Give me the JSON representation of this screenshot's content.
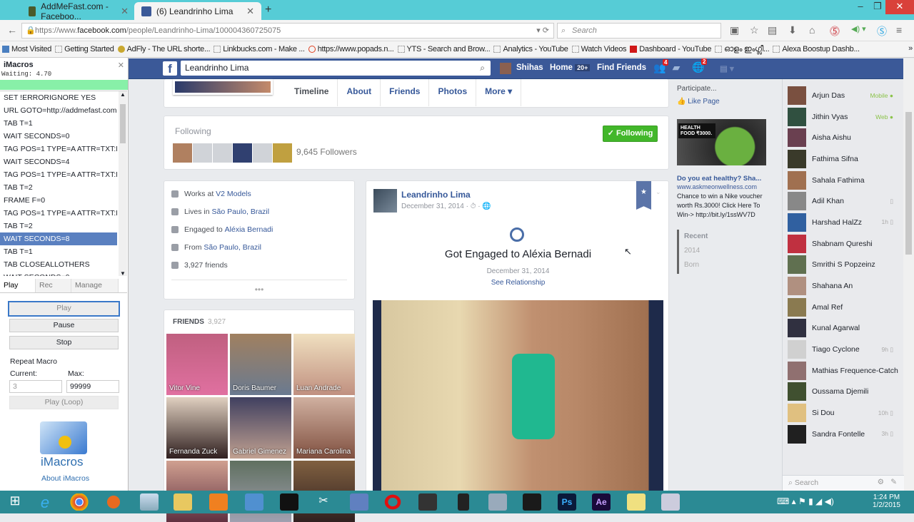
{
  "browser": {
    "tabs": [
      {
        "label": "AddMeFast.com - Faceboo...",
        "active": false
      },
      {
        "label": "(6) Leandrinho Lima",
        "active": true
      }
    ],
    "url_prefix": "https://www.",
    "url_domain": "facebook.com",
    "url_path": "/people/Leandrinho-Lima/100004360725075",
    "search_placeholder": "Search",
    "bookmarks": [
      "Most Visited",
      "Getting Started",
      "AdFly - The URL shorte...",
      "Linkbucks.com - Make ...",
      "https://www.popads.n...",
      "YTS - Search and Brow...",
      "Analytics - YouTube",
      "Watch Videos",
      "Dashboard - YouTube",
      "ഓളം ഇംഗ്ലീ...",
      "Alexa Boostup Dashb..."
    ]
  },
  "imacros": {
    "title": "iMacros",
    "status": "Waiting: 4.70",
    "lines": [
      "SET !ERRORIGNORE YES",
      "URL GOTO=http://addmefast.com...",
      "TAB T=1",
      "WAIT SECONDS=0",
      "TAG POS=1 TYPE=A ATTR=TXT:Fa...",
      "WAIT SECONDS=4",
      "TAG POS=1 TYPE=A ATTR=TXT:Fo...",
      "TAB T=2",
      "FRAME F=0",
      "TAG POS=1 TYPE=A ATTR=TXT:Fo...",
      "TAB T=2",
      "WAIT SECONDS=8",
      "TAB T=1",
      "TAB CLOSEALLOTHERS",
      "WAIT SECONDS=0"
    ],
    "selected_index": 11,
    "tabs": [
      "Play",
      "Rec",
      "Manage"
    ],
    "play": "Play",
    "pause": "Pause",
    "stop": "Stop",
    "repeat_label": "Repeat Macro",
    "current_label": "Current:",
    "max_label": "Max:",
    "current_value": "3",
    "max_value": "99999",
    "play_loop": "Play (Loop)",
    "logo_text": "iMacros",
    "about": "About iMacros"
  },
  "fb": {
    "search_value": "Leandrinho Lima",
    "user": "Shihas",
    "home": "Home",
    "home_badge": "20+",
    "find_friends": "Find Friends",
    "friend_requests_badge": "4",
    "notifications_badge": "2",
    "profile_tabs": [
      "Timeline",
      "About",
      "Friends",
      "Photos",
      "More ▾"
    ],
    "following_label": "Following",
    "followers": "9,645 Followers",
    "following_button": "✓ Following",
    "intro": [
      {
        "icon": "briefcase-icon",
        "text": "Works at ",
        "link": "V2 Models"
      },
      {
        "icon": "home-icon",
        "text": "Lives in ",
        "link": "São Paulo, Brazil"
      },
      {
        "icon": "heart-icon",
        "text": "Engaged to ",
        "link": "Aléxia Bernadi"
      },
      {
        "icon": "pin-icon",
        "text": "From ",
        "link": "São Paulo, Brazil"
      },
      {
        "icon": "friends-icon",
        "text": "3,927 friends",
        "link": ""
      }
    ],
    "friends_title": "FRIENDS",
    "friends_count": "3,927",
    "friends": [
      "Vitor Vine",
      "Doris Baumer",
      "Luan Andrade",
      "Fernanda Zuck",
      "Gabriel Gimenez",
      "Mariana Carolina",
      "",
      "",
      ""
    ],
    "post": {
      "author": "Leandrinho Lima",
      "date": "December 31, 2014 · ⏱ · 🌐",
      "headline": "Got Engaged to Aléxia Bernadi",
      "event_date": "December 31, 2014",
      "see_relationship": "See Relationship"
    },
    "ad": {
      "participate": "Participate...",
      "like_page": "Like Page",
      "image_text": "HEALTH FOOD ₹3000.",
      "title": "Do you eat healthy? Sha...",
      "domain": "www.askmeonwellness.com",
      "body": "Chance to win a Nike voucher worth Rs.3000! Click Here To Win-> http://bit.ly/1ssWV7D"
    },
    "timeline_nav": [
      "Recent",
      "2014",
      "Born"
    ],
    "chat": [
      {
        "name": "Arjun Das",
        "status": "Mobile ●"
      },
      {
        "name": "Jithin Vyas",
        "status": "Web ●"
      },
      {
        "name": "Aisha Aishu",
        "status": ""
      },
      {
        "name": "Fathima Sifna",
        "status": ""
      },
      {
        "name": "Sahala Fathima",
        "status": ""
      },
      {
        "name": "Adil Khan",
        "status": "▯"
      },
      {
        "name": "Harshad HalZz",
        "status": "1h ▯"
      },
      {
        "name": "Shabnam Qureshi",
        "status": ""
      },
      {
        "name": "Smrithi S Popzeinz",
        "status": ""
      },
      {
        "name": "Shahana An",
        "status": ""
      },
      {
        "name": "Amal Ref",
        "status": ""
      },
      {
        "name": "Kunal Agarwal",
        "status": ""
      },
      {
        "name": "Tiago Cyclone",
        "status": "9h ▯"
      },
      {
        "name": "Mathias Frequence-Catch",
        "status": ""
      },
      {
        "name": "Oussama Djemili",
        "status": ""
      },
      {
        "name": "Si Dou",
        "status": "10h ▯"
      },
      {
        "name": "Sandra Fontelle",
        "status": "3h ▯"
      }
    ],
    "chat_search": "Search"
  },
  "taskbar": {
    "time": "1:24 PM",
    "date": "1/2/2015"
  },
  "colors": {
    "fb_blue": "#3b5998",
    "follow_green": "#42b72a",
    "tab_bar": "#56ccd6",
    "taskbar": "#2b8a94"
  }
}
